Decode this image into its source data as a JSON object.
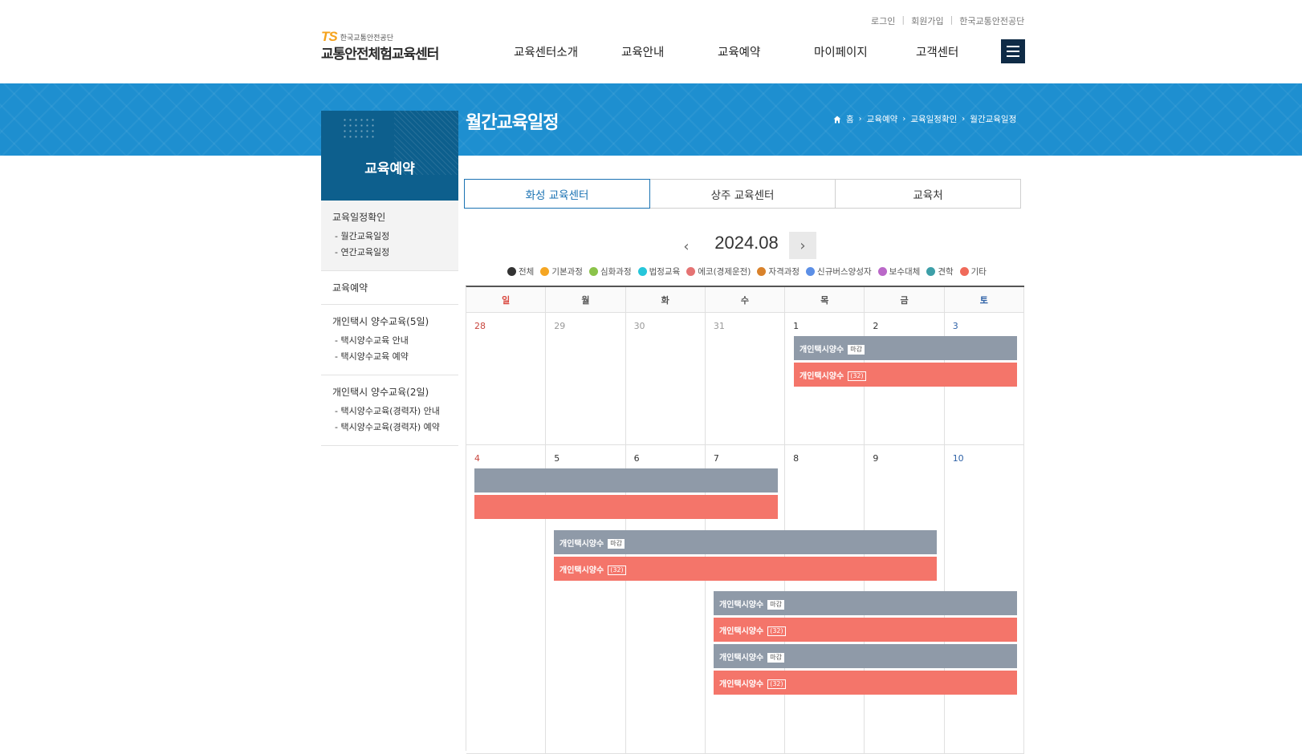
{
  "header": {
    "util_links": [
      "로그인",
      "회원가입",
      "한국교통안전공단"
    ],
    "logo_mark": "TS",
    "logo_org": "한국교통안전공단",
    "logo_title": "교통안전체험교육센터",
    "nav": [
      "교육센터소개",
      "교육안내",
      "교육예약",
      "마이페이지",
      "고객센터"
    ]
  },
  "banner": {
    "title": "월간교육일정",
    "breadcrumb": [
      "홈",
      "교육예약",
      "교육일정확인",
      "월간교육일정"
    ]
  },
  "sidebar": {
    "title": "교육예약",
    "groups": [
      {
        "title": "교육일정확인",
        "items": [
          "- 월간교육일정",
          "- 연간교육일정"
        ]
      },
      {
        "title": "교육예약",
        "items": []
      },
      {
        "title": "개인택시 양수교육(5일)",
        "items": [
          "- 택시양수교육 안내",
          "- 택시양수교육 예약"
        ]
      },
      {
        "title": "개인택시 양수교육(2일)",
        "items": [
          "- 택시양수교육(경력자) 안내",
          "- 택시양수교육(경력자) 예약"
        ]
      }
    ]
  },
  "tabs": [
    "화성 교육센터",
    "상주 교육센터",
    "교육처"
  ],
  "calendar_nav": {
    "month": "2024.08",
    "prev_icon": "chevron-left-icon",
    "next_icon": "chevron-right-icon"
  },
  "legend": [
    {
      "label": "전체",
      "color": "#333333"
    },
    {
      "label": "기본과정",
      "color": "#f5a623"
    },
    {
      "label": "심화과정",
      "color": "#8bc34a"
    },
    {
      "label": "법정교육",
      "color": "#26c6da"
    },
    {
      "label": "에코(경제운전)",
      "color": "#e57373"
    },
    {
      "label": "자격과정",
      "color": "#d9822b"
    },
    {
      "label": "신규버스양성자",
      "color": "#5c8fe6"
    },
    {
      "label": "보수대체",
      "color": "#ba68c8"
    },
    {
      "label": "견학",
      "color": "#3d9fa8"
    },
    {
      "label": "기타",
      "color": "#f06a5a"
    }
  ],
  "weekdays": [
    "일",
    "월",
    "화",
    "수",
    "목",
    "금",
    "토"
  ],
  "weeks": [
    [
      "28",
      "29",
      "30",
      "31",
      "1",
      "2",
      "3"
    ],
    [
      "4",
      "5",
      "6",
      "7",
      "8",
      "9",
      "10"
    ]
  ],
  "events": {
    "name": "개인택시양수",
    "closed_badge": "마감",
    "count_badge": "(32)",
    "colors": {
      "closed": "#8f9aa8",
      "open": "#f4756a"
    }
  }
}
